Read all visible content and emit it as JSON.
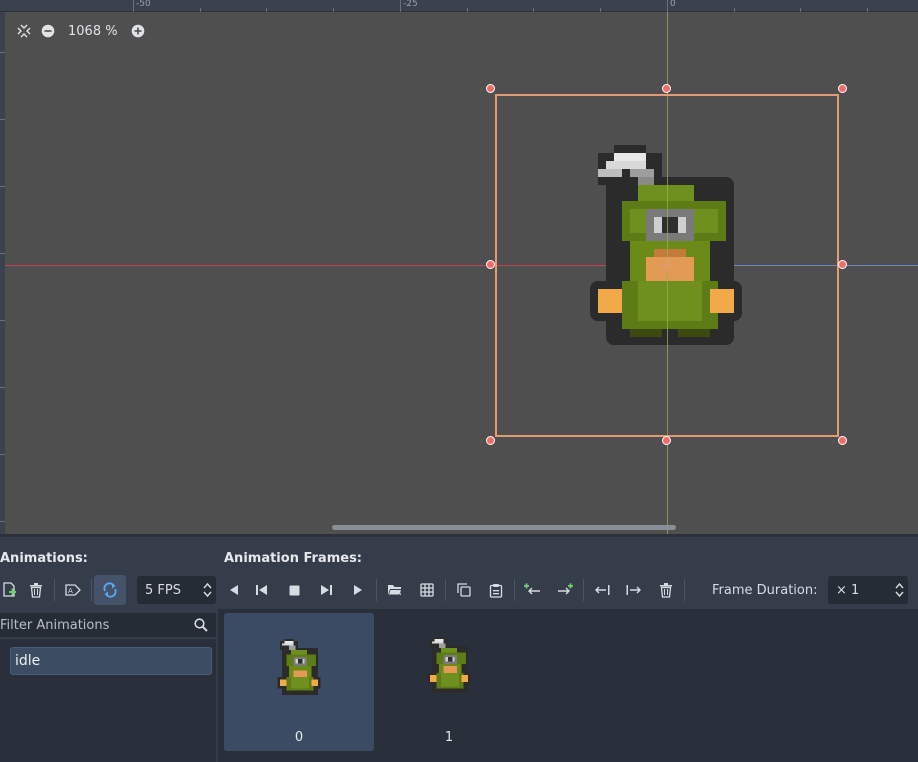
{
  "viewport": {
    "zoom_label": "1068 %",
    "ruler_labels": [
      "-50",
      "-25",
      "0"
    ],
    "colors": {
      "canvas_bg": "#4f4f4f",
      "sprite_rect": "#e59a73",
      "handle": "#f26a6a",
      "guide_x": "#8fb35a",
      "guide_y": "#d6434e"
    }
  },
  "animations_panel": {
    "title": "Animations:",
    "filter_placeholder": "Filter Animations",
    "items": [
      {
        "label": "idle",
        "selected": true
      }
    ]
  },
  "frames_panel": {
    "title": "Animation Frames:",
    "fps_value": "5 FPS",
    "frame_duration_label": "Frame Duration:",
    "frame_duration_value": "× 1",
    "frames": [
      {
        "label": "0",
        "selected": true
      },
      {
        "label": "1",
        "selected": false
      }
    ]
  },
  "icons": {
    "zoom_toolbar": [
      "center-view-icon",
      "zoom-out-icon",
      "zoom-in-icon"
    ],
    "anim_toolbar": [
      "new-animation-icon",
      "delete-animation-icon",
      "autoplay-on-load-icon",
      "loop-icon"
    ],
    "frames_toolbar": [
      "play-backwards-icon",
      "step-backward-icon",
      "stop-icon",
      "step-forward-icon",
      "play-icon",
      "load-from-file-icon",
      "load-spritesheet-icon",
      "copy-frame-icon",
      "paste-frame-icon",
      "insert-before-icon",
      "insert-after-icon",
      "move-left-icon",
      "move-right-icon",
      "delete-frame-icon"
    ]
  }
}
